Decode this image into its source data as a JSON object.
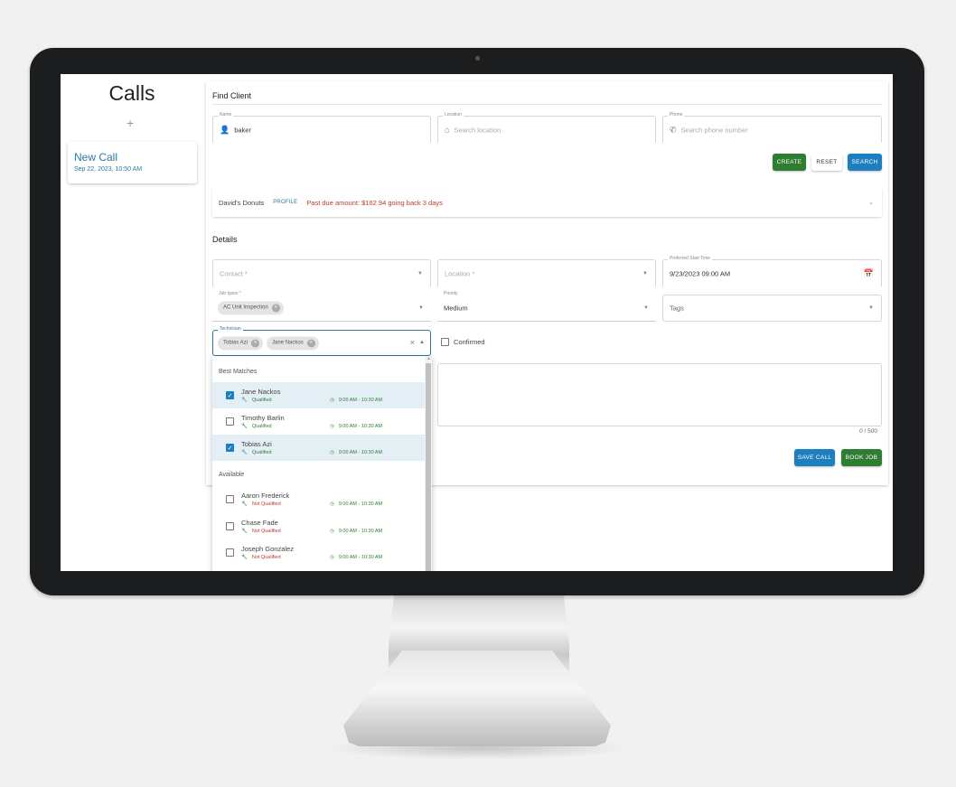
{
  "sidebar": {
    "title": "Calls",
    "add_icon": "plus",
    "calls": [
      {
        "title": "New Call",
        "date": "Sep 22, 2023, 10:50 AM"
      }
    ]
  },
  "find_client": {
    "title": "Find Client",
    "name": {
      "label": "Name",
      "value": "baker",
      "icon": "person-icon"
    },
    "location": {
      "label": "Location",
      "placeholder": "Search location",
      "icon": "home-icon"
    },
    "phone": {
      "label": "Phone",
      "placeholder": "Search phone number",
      "icon": "phone-icon"
    },
    "buttons": {
      "create": "CREATE",
      "reset": "RESET",
      "search": "SEARCH"
    },
    "result": {
      "name": "David's Donuts",
      "profile_label": "PROFILE",
      "past_due": "Past due amount: $162.94 going back 3 days"
    }
  },
  "details": {
    "title": "Details",
    "contact": {
      "label": "Contact *"
    },
    "location": {
      "label": "Location *"
    },
    "start_time": {
      "label": "Preferred Start Time",
      "value": "9/23/2023 09:00 AM"
    },
    "job_types": {
      "label": "Job types *",
      "chips": [
        "AC Unit Inspection"
      ]
    },
    "priority": {
      "label": "Priority",
      "value": "Medium"
    },
    "tags": {
      "label": "Tags"
    },
    "technician": {
      "label": "Technician",
      "chips": [
        "Tobias Azi",
        "Jane Nackos"
      ]
    },
    "confirmed": {
      "label": "Confirmed",
      "checked": false
    },
    "notes_counter": "0 / 500",
    "buttons": {
      "save_call": "SAVE CALL",
      "book_job": "BOOK JOB"
    }
  },
  "technician_dropdown": {
    "groups": [
      {
        "label": "Best Matches",
        "options": [
          {
            "name": "Jane Nackos",
            "qualification": "Qualified",
            "time": "9:00 AM - 10:30 AM",
            "checked": true
          },
          {
            "name": "Timothy Barlin",
            "qualification": "Qualified",
            "time": "9:00 AM - 10:30 AM",
            "checked": false
          },
          {
            "name": "Tobias Azi",
            "qualification": "Qualified",
            "time": "9:00 AM - 10:30 AM",
            "checked": true
          }
        ]
      },
      {
        "label": "Available",
        "options": [
          {
            "name": "Aaron Frederick",
            "qualification": "Not Qualified",
            "time": "9:00 AM - 10:30 AM",
            "checked": false
          },
          {
            "name": "Chase Fade",
            "qualification": "Not Qualified",
            "time": "9:00 AM - 10:30 AM",
            "checked": false
          },
          {
            "name": "Joseph Gonzalez",
            "qualification": "Not Qualified",
            "time": "9:00 AM - 10:30 AM",
            "checked": false
          }
        ]
      }
    ]
  },
  "colors": {
    "primary_blue": "#1e7fc0",
    "green": "#2e7d32",
    "link_teal": "#2b7a9e",
    "warning_red": "#c0392b",
    "selected_bg": "#e4eff5"
  }
}
